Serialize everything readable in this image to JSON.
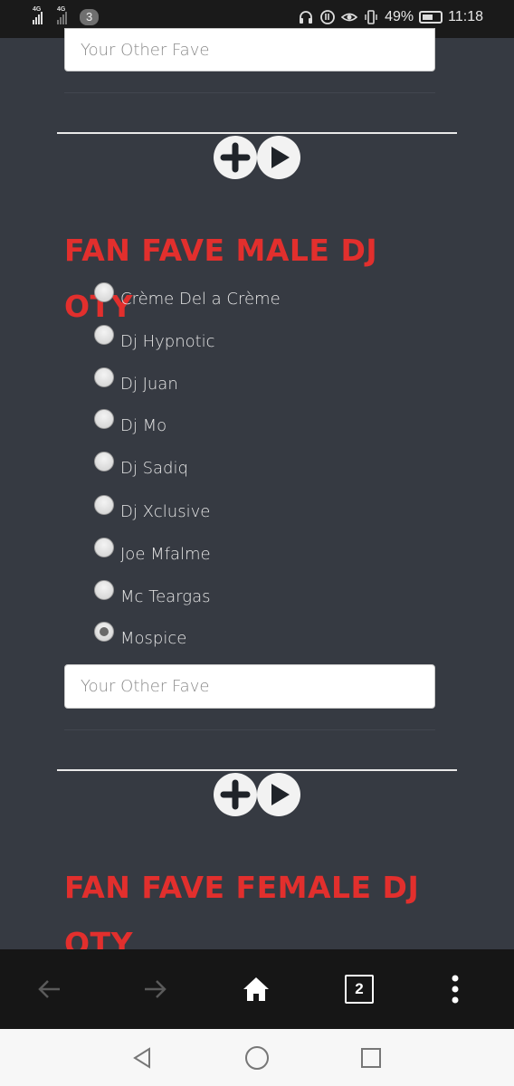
{
  "status_bar": {
    "network_1": "4G",
    "network_2": "4G",
    "notification_count": "3",
    "battery": "49%",
    "time": "11:18"
  },
  "form": {
    "other_fave_placeholder": "Your Other Fave",
    "section_male": {
      "title": "FAN FAVE MALE DJ OTY",
      "options": [
        {
          "label": "Crème Del a Crème",
          "checked": false
        },
        {
          "label": "Dj Hypnotic",
          "checked": false
        },
        {
          "label": "Dj Juan",
          "checked": false
        },
        {
          "label": "Dj Mo",
          "checked": false
        },
        {
          "label": "Dj Sadiq",
          "checked": false
        },
        {
          "label": "Dj Xclusive",
          "checked": false
        },
        {
          "label": "Joe Mfalme",
          "checked": false
        },
        {
          "label": "Mc Teargas",
          "checked": false
        },
        {
          "label": "Mospice",
          "checked": true
        }
      ],
      "selected": "Mospice"
    },
    "section_female": {
      "title": "FAN FAVE FEMALE DJ OTY"
    }
  },
  "browser_toolbar": {
    "tabs_count": "2",
    "icons": [
      "back-arrow-icon",
      "forward-arrow-icon",
      "home-icon",
      "tabs-icon",
      "more-vert-icon"
    ]
  },
  "system_nav": {
    "icons": [
      "back-triangle-icon",
      "home-circle-icon",
      "recents-square-icon"
    ]
  },
  "colors": {
    "background": "#363a42",
    "title_red": "#e22f2d",
    "option_text": "#e6e6e6"
  }
}
